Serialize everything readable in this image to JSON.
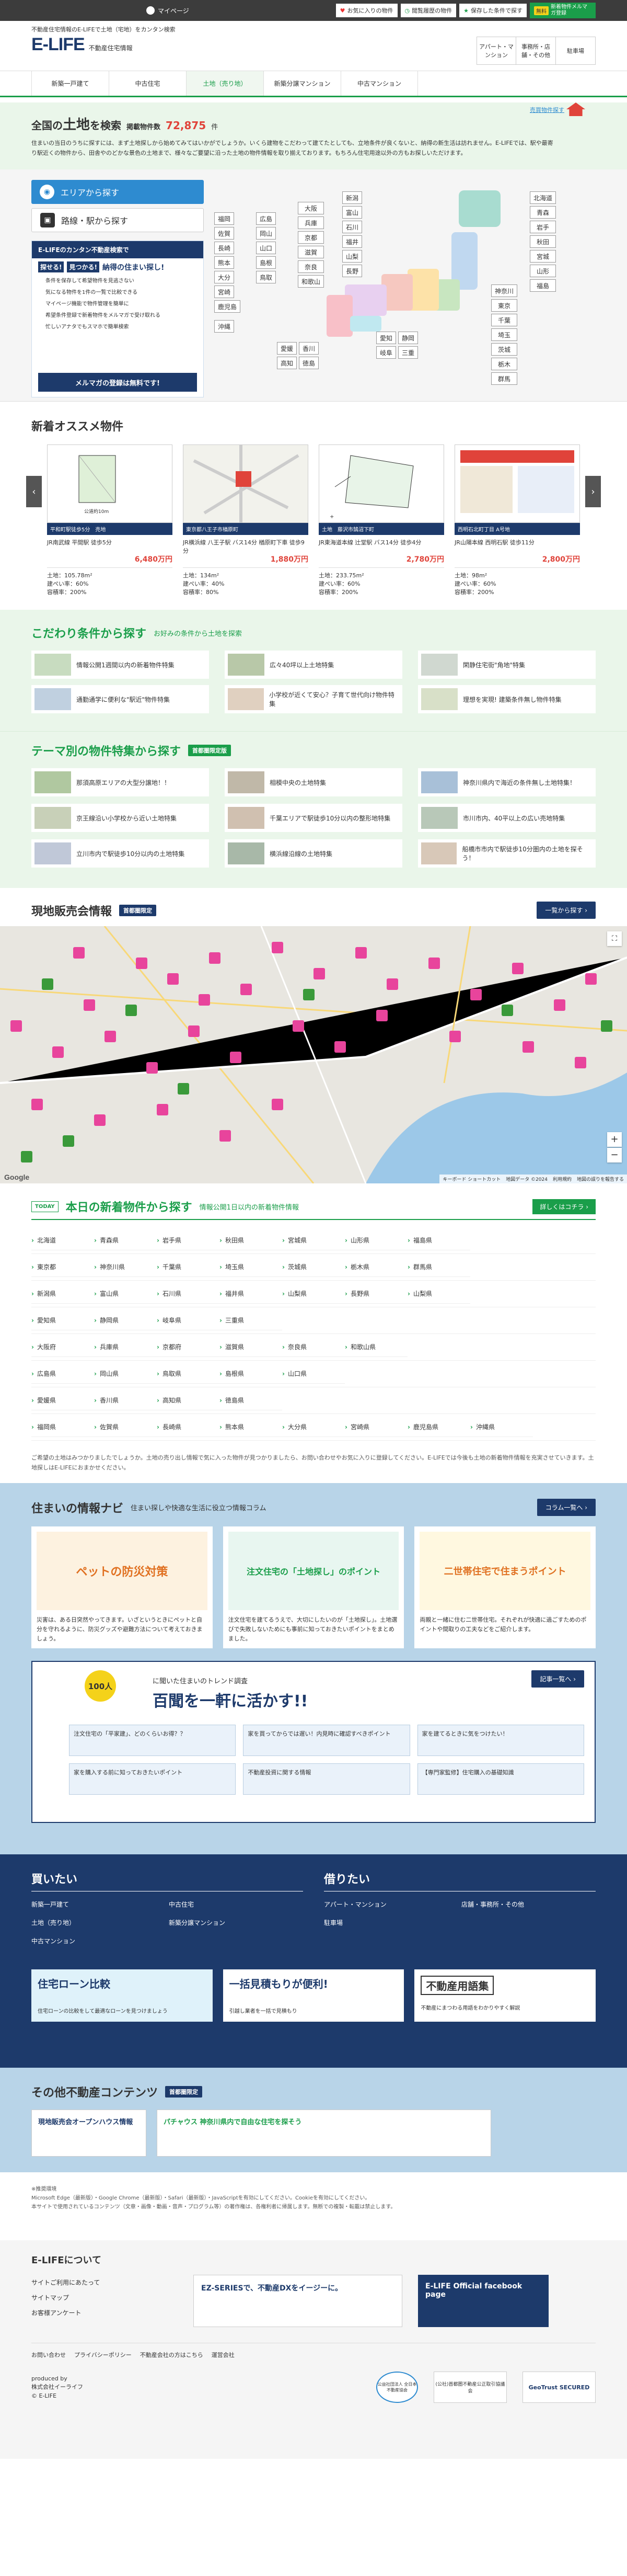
{
  "topbar": {
    "mypage": "マイページ",
    "links": [
      "お気に入りの物件",
      "閲覧履歴の物件",
      "保存した条件で探す"
    ],
    "register": "無料 新着物件メルマガ登録",
    "register_top": "無料",
    "register_bottom": "新着物件メルマガ登録"
  },
  "header": {
    "tagline": "不動産住宅情報のE-LIFEで土地（宅地）をカンタン検索",
    "logo": "E-LIFE",
    "logo_sub": "不動産住宅情報",
    "right_links": [
      "アパート・マンション",
      "事務所・店舗・その他",
      "駐車場"
    ]
  },
  "nav": {
    "items": [
      "新築一戸建て",
      "中古住宅",
      "土地（売り地）",
      "新築分譲マンション",
      "中古マンション"
    ]
  },
  "hero": {
    "title_pre": "全国の",
    "title_big": "土地",
    "title_post": "を検索",
    "count_label": "掲載物件数",
    "count": "72,875",
    "count_unit": "件",
    "desc": "住まいにとってのかの事を考えたときのキ、まずき地探しから始めてみてはいかがでしょうか。いくら建物をこだわって建てたとしても、立地条件が良くないと、納得の新生活は訪れません。E-LIFEでは、駅や最寄りの条件の中から、希望に合った土地を探すことができます。エリアの中から、理想に合った土地を、駅から検索したり、思い通りの場所を探せます。",
    "desc2": "住まいの当日のうちに探すには、まず土地探しから始めてみてはいかがでしょうか。いくら建物をこだわって建てたとしても、立地条件が良くないと、納得の新生活は訪れません。E-LIFEでは、駅や最寄り駅近くの物件から、田舎やのどかな景色の土地まで、様々なご要望に沿った土地の物件情報を取り揃えております。もちろん住宅用途以外の方もお探しいただけます。",
    "link": "売買物件探す"
  },
  "search": {
    "area_tab": "エリアから探す",
    "line_tab": "路線・駅から探す",
    "promo_title": "E-LIFEのカンタン不動産検索で",
    "promo_sub1": "探せる!",
    "promo_sub2": "見つかる!",
    "promo_sub3": "納得の住まい探し!",
    "promo_items": [
      "条件を保存して希望物件を見逃さない",
      "気になる物件を1件の一覧で比較できる",
      "マイページ機能で物件管理を簡単に",
      "希望条件登録で新着物件をメルマガで受け取れる",
      "忙しいアナタでもスマホで簡単検索"
    ],
    "mail": "メルマガの登録は無料です!",
    "west": [
      [
        "福岡",
        "広島",
        "兵庫"
      ],
      [
        "佐賀",
        "岡山",
        "大阪"
      ],
      [
        "長崎",
        "山口",
        "京都"
      ],
      [
        "熊本",
        "島根",
        "滋賀"
      ],
      [
        "大分",
        "鳥取",
        "奈良"
      ],
      [
        "宮崎",
        "",
        "和歌山"
      ],
      [
        "鹿児島"
      ],
      [
        "沖縄"
      ]
    ],
    "col_center": [
      "大阪",
      "兵庫",
      "京都",
      "滋賀",
      "奈良",
      "和歌山"
    ],
    "col_mid": [
      "新潟",
      "富山",
      "石川",
      "福井",
      "山梨",
      "長野",
      "岐阜",
      "静岡"
    ],
    "col_shikoku": [
      "愛媛",
      "香川",
      "高知",
      "徳島"
    ],
    "col_tokai": [
      "愛知",
      "静岡",
      "岐阜",
      "三重"
    ],
    "col_north": [
      "北海道",
      "青森",
      "岩手",
      "秋田",
      "宮城",
      "山形",
      "福島"
    ],
    "col_kanto": [
      "神奈川",
      "東京",
      "千葉",
      "埼玉",
      "茨城",
      "栃木",
      "群馬"
    ]
  },
  "recommend": {
    "title": "新着オススメ物件",
    "items": [
      {
        "label": "平和町駅徒歩5分　売地",
        "name": "JR南武線 平間駅 徒歩5分",
        "price": "6,480万円",
        "land": "土地：105.78m²",
        "bcr": "建ぺい率：60%",
        "far": "容積率：200%",
        "img": "plan"
      },
      {
        "label": "東京都八王子市楢原町",
        "name": "JR横浜線 八王子駅 バス14分 楢原町下車 徒歩9分",
        "price": "1,880万円",
        "land": "土地：134m²",
        "bcr": "建ぺい率：40%",
        "far": "容積率：80%",
        "img": "map"
      },
      {
        "label": "土地　藤沢市鵠沼下町",
        "name": "JR東海道本線 辻堂駅 バス14分 徒歩4分",
        "price": "2,780万円",
        "land": "土地：233.75m²",
        "bcr": "建ぺい率：60%",
        "far": "容積率：200%",
        "img": "plan2"
      },
      {
        "label": "西明石北町丁目 A号地",
        "name": "JR山陽本線 西明石駅 徒歩11分",
        "price": "2,800万円",
        "land": "土地：98m²",
        "bcr": "建ぺい率：60%",
        "far": "容積率：200%",
        "img": "flyer"
      }
    ]
  },
  "kodawari": {
    "title": "こだわり条件から探す",
    "sub": "お好みの条件から土地を探索",
    "items": [
      "情報公開1週間以内の新着物件特集",
      "広々40坪以上土地特集",
      "閑静住宅街\"角地\"特集",
      "通勤通学に便利な\"駅近\"物件特集",
      "小学校が近くて安心？子育て世代向け物件特集",
      "理想を実現! 建築条件無し物件特集"
    ]
  },
  "theme": {
    "title": "テーマ別の物件特集から探す",
    "badge": "首都圏限定版",
    "items": [
      "那須高原エリアの大型分譲地！！",
      "相模中央の土地特集",
      "神奈川県内で海近の条件無し土地特集！",
      "京王線沿い小学校から近い土地特集",
      "千葉エリアで駅徒歩10分以内の整形地特集",
      "市川市内、40平以上の広い売地特集",
      "立川市内で駅徒歩10分以内の土地特集",
      "横浜線沿線の土地特集",
      "船橋市市内で駅徒歩10分圏内の土地を探そう！"
    ]
  },
  "mapsec": {
    "title": "現地販売会情報",
    "badge": "首都圏限定",
    "btn": "一覧から探す",
    "labels": [
      "Google",
      "キーボード ショートカット",
      "地図データ ©2024",
      "利用規約",
      "地図の誤りを報告する"
    ]
  },
  "today": {
    "title": "本日の新着物件から探す",
    "sub": "情報公開1日以内の新着物件情報",
    "btn": "詳しくはコチラ",
    "tag": "TODAY",
    "rows": [
      [
        "北海道",
        "青森県",
        "岩手県",
        "秋田県",
        "宮城県",
        "山形県",
        "福島県"
      ],
      [
        "東京都",
        "神奈川県",
        "千葉県",
        "埼玉県",
        "茨城県",
        "栃木県",
        "群馬県"
      ],
      [
        "新潟県",
        "富山県",
        "石川県",
        "福井県",
        "山梨県",
        "長野県",
        "山梨県"
      ],
      [
        "愛知県",
        "静岡県",
        "岐阜県",
        "三重県"
      ],
      [
        "大阪府",
        "兵庫県",
        "京都府",
        "滋賀県",
        "奈良県",
        "和歌山県"
      ],
      [
        "広島県",
        "岡山県",
        "鳥取県",
        "島根県",
        "山口県"
      ],
      [
        "愛媛県",
        "香川県",
        "高知県",
        "徳島県"
      ],
      [
        "福岡県",
        "佐賀県",
        "長崎県",
        "熊本県",
        "大分県",
        "宮崎県",
        "鹿児島県",
        "沖縄県"
      ]
    ]
  },
  "notice": "ご希望の土地はみつかりましたでしょうか。土地の売り出し情報で気に入った物件が見つかりましたら、お問い合わせやお気に入りに登録してください。E-LIFEでは今後も土地の新着物件情報を充実させていきます。土地探しはE-LIFEにおまかせください。",
  "info": {
    "title": "住まいの情報ナビ",
    "sub": "住まい探しや快適な生活に役立つ情報コラム",
    "btn": "コラム一覧へ",
    "cards": [
      {
        "img": "ペットの防災対策",
        "text": "災害は、ある日突然やってきます。いざというときにペットと自分を守れるように、防災グッズや避難方法について考えておきましょう。"
      },
      {
        "img": "注文住宅の「土地探し」のポイント",
        "text": "注文住宅を建てるうえで、大切にしたいのが「土地探し」。土地選びで失敗しないためにも事前に知っておきたいポイントをまとめました。"
      },
      {
        "img": "二世帯住宅で住まうポイント",
        "text": "両親と一緒に住む二世帯住宅。それぞれが快適に過ごすためのポイントや間取りの工夫などをご紹介します。"
      }
    ],
    "survey_title": "百聞を一軒に活かす!!",
    "survey_sub": "に聞いた住まいのトレンド調査",
    "survey_num": "100人",
    "survey_btn": "記事一覧へ",
    "survey_items": [
      "注文住宅の「平家建」、どのくらいお得？？",
      "家を買ってからでは遅い！内見時に確認すべきポイント",
      "家を建てるときに気をつけたい！",
      "家を購入する前に知っておきたいポイント",
      "不動産投資に関する情報",
      "【専門家監修】住宅購入の基礎知識"
    ]
  },
  "buy": {
    "title": "買いたい",
    "items": [
      "新築一戸建て",
      "中古住宅",
      "土地（売り地）",
      "新築分譲マンション",
      "中古マンション"
    ]
  },
  "rent": {
    "title": "借りたい",
    "items": [
      "アパート・マンション",
      "店舗・事務所・その他",
      "駐車場"
    ]
  },
  "banners": [
    "住宅ローン比較",
    "一括見積もりが便利!",
    "不動産用語集"
  ],
  "banner_subs": [
    "住宅ローンの比較をして最適なローンを見つけましょう",
    "引越し業者を一括で見積もり",
    "不動産にまつわる用語をわかりやすく解説"
  ],
  "other": {
    "title": "その他不動産コンテンツ",
    "badge": "首都圏限定",
    "items": [
      "現地販売会オープンハウス情報",
      "パチャウス 神奈川県内で自由な住宅を探そう"
    ]
  },
  "disclaimer": "※推奨環境\nMicrosoft Edge（最新版）・Google Chrome（最新版）・Safari（最新版）・JavaScriptを有効にしてください。Cookieを有効にしてください。\n本サイトで使用されているコンテンツ（文章・画像・動画・音声・プログラム等）の著作権は、各権利者に帰属します。無断での複製・転載は禁止します。",
  "about": {
    "title": "E-LIFEについて",
    "links": [
      "サイトご利用にあたって",
      "サイトマップ",
      "お客様アンケート"
    ],
    "ez": "EZ-SERIESで、不動産DXをイージーに。",
    "fb": "E-LIFE Official facebook page",
    "footer_links": [
      "お問い合わせ",
      "プライバシーポリシー",
      "不動産会社の方はこちら",
      "運営会社"
    ],
    "company": "produced by\n株式会社イーライフ\n© E-LIFE",
    "seals": [
      "公益社団法人 全日本不動産協会",
      "(公社)首都圏不動産公正取引協議会",
      "GeoTrust SECURED"
    ]
  },
  "colors": {
    "green": "#1a9e4a",
    "navy": "#1d3a6b",
    "blue": "#2e8bd0",
    "lightgreen": "#eaf6ea"
  }
}
